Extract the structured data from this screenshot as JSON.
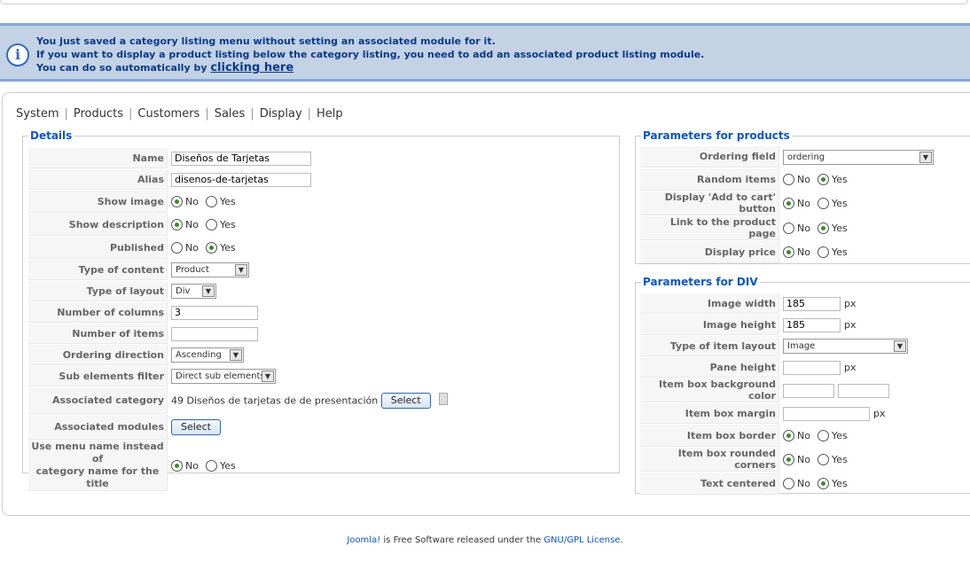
{
  "notice": {
    "line1": "You just saved a category listing menu without setting an associated module for it.",
    "line2": "If you want to display a product listing below the category listing, you need to add an associated product listing module.",
    "line3_prefix": "You can do so automatically by",
    "link": "clicking here"
  },
  "tabs": [
    "System",
    "Products",
    "Customers",
    "Sales",
    "Display",
    "Help"
  ],
  "details": {
    "legend": "Details",
    "name_label": "Name",
    "name_value": "Diseños de Tarjetas",
    "alias_label": "Alias",
    "alias_value": "disenos-de-tarjetas",
    "show_image_label": "Show image",
    "show_description_label": "Show description",
    "published_label": "Published",
    "type_content_label": "Type of content",
    "type_content_value": "Product",
    "type_layout_label": "Type of layout",
    "type_layout_value": "Div",
    "num_columns_label": "Number of columns",
    "num_columns_value": "3",
    "num_items_label": "Number of items",
    "num_items_value": "",
    "ordering_dir_label": "Ordering direction",
    "ordering_dir_value": "Ascending",
    "sub_filter_label": "Sub elements filter",
    "sub_filter_value": "Direct sub elements",
    "assoc_category_label": "Associated category",
    "assoc_category_value": "49 Diseños de tarjetas de de presentación",
    "assoc_modules_label": "Associated modules",
    "menu_name_label_1": "Use menu name instead of",
    "menu_name_label_2": "category name for the title",
    "select_label": "Select"
  },
  "radio": {
    "no": "No",
    "yes": "Yes"
  },
  "products": {
    "legend": "Parameters for products",
    "ordering_field_label": "Ordering field",
    "ordering_field_value": "ordering",
    "random_items_label": "Random items",
    "add_to_cart_label": "Display 'Add to cart' button",
    "link_product_label": "Link to the product page",
    "display_price_label": "Display price"
  },
  "div": {
    "legend": "Parameters for DIV",
    "image_width_label": "Image width",
    "image_width_value": "185",
    "image_height_label": "Image height",
    "image_height_value": "185",
    "item_layout_label": "Type of item layout",
    "item_layout_value": "Image",
    "pane_height_label": "Pane height",
    "bg_color_label": "Item box background color",
    "box_margin_label": "Item box margin",
    "box_border_label": "Item box border",
    "rounded_label": "Item box rounded corners",
    "text_centered_label": "Text centered",
    "px": "px"
  },
  "footer": {
    "joomla": "Joomla!",
    "middle": " is Free Software released under the ",
    "license": "GNU/GPL License",
    "end": "."
  }
}
